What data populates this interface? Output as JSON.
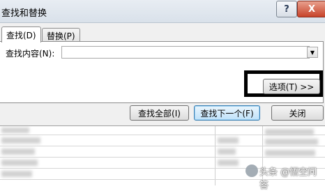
{
  "window": {
    "title": "查找和替换",
    "help_label": "?",
    "close_label": "X"
  },
  "tabs": {
    "find": "查找(D)",
    "replace": "替换(P)"
  },
  "find": {
    "label": "查找内容(N):",
    "value": ""
  },
  "buttons": {
    "options": "选项(T) >>",
    "find_all": "查找全部(I)",
    "find_next": "查找下一个(F)",
    "close": "关闭"
  },
  "watermark": "头条 @悟空问答"
}
